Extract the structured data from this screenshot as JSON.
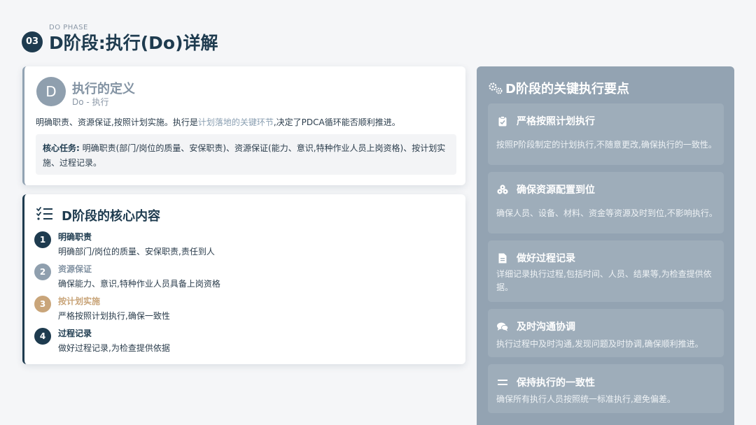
{
  "header": {
    "badge": "03",
    "subtitle": "DO PHASE",
    "title": "D阶段:执行(Do)详解"
  },
  "definition": {
    "avatar": "D",
    "title": "执行的定义",
    "subtitle": "Do - 执行",
    "text_before": "明确职责、资源保证,按照计划实施。执行是",
    "text_highlight": "计划落地的关键环节",
    "text_after": ",决定了PDCA循环能否顺利推进。",
    "task_label": "核心任务:",
    "task_text": " 明确职责(部门/岗位的质量、安保职责)、资源保证(能力、意识,特种作业人员上岗资格)、按计划实施、过程记录。"
  },
  "core": {
    "title": "D阶段的核心内容",
    "icon": "list-check-icon",
    "items": [
      {
        "num": "1",
        "title": "明确职责",
        "desc": "明确部门/岗位的质量、安保职责,责任到人",
        "color": "#1e3b4f"
      },
      {
        "num": "2",
        "title": "资源保证",
        "desc": "确保能力、意识,特种作业人员具备上岗资格",
        "color": "#8f9fae"
      },
      {
        "num": "3",
        "title": "按计划实施",
        "desc": "严格按照计划执行,确保一致性",
        "color": "#c9a57a"
      },
      {
        "num": "4",
        "title": "过程记录",
        "desc": "做好过程记录,为检查提供依据",
        "color": "#1e3b4f"
      }
    ]
  },
  "panel": {
    "title": "D阶段的关键执行要点",
    "icon": "gears-icon",
    "points": [
      {
        "icon": "clipboard-check-icon",
        "title": "严格按照计划执行",
        "desc": "按照P阶段制定的计划执行,不随意更改,确保执行的一致性。"
      },
      {
        "icon": "cubes-icon",
        "title": "确保资源配置到位",
        "desc": "确保人员、设备、材料、资金等资源及时到位,不影响执行。"
      },
      {
        "icon": "file-icon",
        "title": "做好过程记录",
        "desc": "详细记录执行过程,包括时间、人员、结果等,为检查提供依据。"
      },
      {
        "icon": "comments-icon",
        "title": "及时沟通协调",
        "desc": "执行过程中及时沟通,发现问题及时协调,确保顺利推进。"
      },
      {
        "icon": "equals-icon",
        "title": "保持执行的一致性",
        "desc": "确保所有执行人员按照统一标准执行,避免偏差。"
      }
    ]
  }
}
